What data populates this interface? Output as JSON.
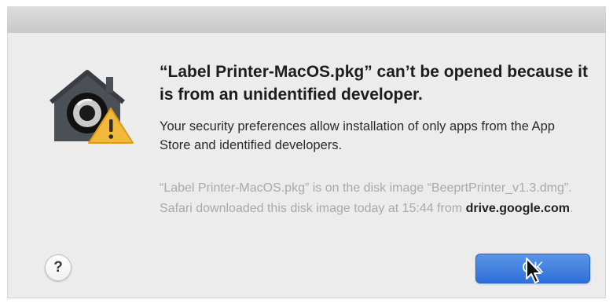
{
  "dialog": {
    "icon": "gatekeeper-warning-icon",
    "title": "“Label Printer-MacOS.pkg” can’t be opened because it is from an unidentified developer.",
    "message": "Your security preferences allow installation of only apps from the App Store and identified developers.",
    "info_prefix": "“Label Printer-MacOS.pkg” is on the disk image “BeeprtPrinter_v1.3.dmg”. Safari downloaded this disk image today at 15:44 from ",
    "info_domain": "drive.google.com",
    "info_suffix": ".",
    "help_label": "?",
    "ok_label": "OK"
  },
  "colors": {
    "dialog_background": "#ececec",
    "ok_button": "#3a7be0",
    "info_text": "#a9a9a9",
    "warning_triangle": "#f2b83a"
  }
}
